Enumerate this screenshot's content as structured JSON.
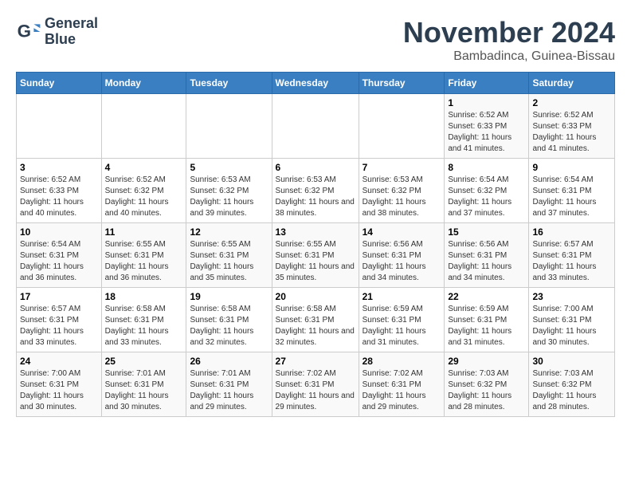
{
  "logo": {
    "line1": "General",
    "line2": "Blue"
  },
  "title": "November 2024",
  "location": "Bambadinca, Guinea-Bissau",
  "weekdays": [
    "Sunday",
    "Monday",
    "Tuesday",
    "Wednesday",
    "Thursday",
    "Friday",
    "Saturday"
  ],
  "weeks": [
    [
      {
        "day": "",
        "info": ""
      },
      {
        "day": "",
        "info": ""
      },
      {
        "day": "",
        "info": ""
      },
      {
        "day": "",
        "info": ""
      },
      {
        "day": "",
        "info": ""
      },
      {
        "day": "1",
        "info": "Sunrise: 6:52 AM\nSunset: 6:33 PM\nDaylight: 11 hours and 41 minutes."
      },
      {
        "day": "2",
        "info": "Sunrise: 6:52 AM\nSunset: 6:33 PM\nDaylight: 11 hours and 41 minutes."
      }
    ],
    [
      {
        "day": "3",
        "info": "Sunrise: 6:52 AM\nSunset: 6:33 PM\nDaylight: 11 hours and 40 minutes."
      },
      {
        "day": "4",
        "info": "Sunrise: 6:52 AM\nSunset: 6:32 PM\nDaylight: 11 hours and 40 minutes."
      },
      {
        "day": "5",
        "info": "Sunrise: 6:53 AM\nSunset: 6:32 PM\nDaylight: 11 hours and 39 minutes."
      },
      {
        "day": "6",
        "info": "Sunrise: 6:53 AM\nSunset: 6:32 PM\nDaylight: 11 hours and 38 minutes."
      },
      {
        "day": "7",
        "info": "Sunrise: 6:53 AM\nSunset: 6:32 PM\nDaylight: 11 hours and 38 minutes."
      },
      {
        "day": "8",
        "info": "Sunrise: 6:54 AM\nSunset: 6:32 PM\nDaylight: 11 hours and 37 minutes."
      },
      {
        "day": "9",
        "info": "Sunrise: 6:54 AM\nSunset: 6:31 PM\nDaylight: 11 hours and 37 minutes."
      }
    ],
    [
      {
        "day": "10",
        "info": "Sunrise: 6:54 AM\nSunset: 6:31 PM\nDaylight: 11 hours and 36 minutes."
      },
      {
        "day": "11",
        "info": "Sunrise: 6:55 AM\nSunset: 6:31 PM\nDaylight: 11 hours and 36 minutes."
      },
      {
        "day": "12",
        "info": "Sunrise: 6:55 AM\nSunset: 6:31 PM\nDaylight: 11 hours and 35 minutes."
      },
      {
        "day": "13",
        "info": "Sunrise: 6:55 AM\nSunset: 6:31 PM\nDaylight: 11 hours and 35 minutes."
      },
      {
        "day": "14",
        "info": "Sunrise: 6:56 AM\nSunset: 6:31 PM\nDaylight: 11 hours and 34 minutes."
      },
      {
        "day": "15",
        "info": "Sunrise: 6:56 AM\nSunset: 6:31 PM\nDaylight: 11 hours and 34 minutes."
      },
      {
        "day": "16",
        "info": "Sunrise: 6:57 AM\nSunset: 6:31 PM\nDaylight: 11 hours and 33 minutes."
      }
    ],
    [
      {
        "day": "17",
        "info": "Sunrise: 6:57 AM\nSunset: 6:31 PM\nDaylight: 11 hours and 33 minutes."
      },
      {
        "day": "18",
        "info": "Sunrise: 6:58 AM\nSunset: 6:31 PM\nDaylight: 11 hours and 33 minutes."
      },
      {
        "day": "19",
        "info": "Sunrise: 6:58 AM\nSunset: 6:31 PM\nDaylight: 11 hours and 32 minutes."
      },
      {
        "day": "20",
        "info": "Sunrise: 6:58 AM\nSunset: 6:31 PM\nDaylight: 11 hours and 32 minutes."
      },
      {
        "day": "21",
        "info": "Sunrise: 6:59 AM\nSunset: 6:31 PM\nDaylight: 11 hours and 31 minutes."
      },
      {
        "day": "22",
        "info": "Sunrise: 6:59 AM\nSunset: 6:31 PM\nDaylight: 11 hours and 31 minutes."
      },
      {
        "day": "23",
        "info": "Sunrise: 7:00 AM\nSunset: 6:31 PM\nDaylight: 11 hours and 30 minutes."
      }
    ],
    [
      {
        "day": "24",
        "info": "Sunrise: 7:00 AM\nSunset: 6:31 PM\nDaylight: 11 hours and 30 minutes."
      },
      {
        "day": "25",
        "info": "Sunrise: 7:01 AM\nSunset: 6:31 PM\nDaylight: 11 hours and 30 minutes."
      },
      {
        "day": "26",
        "info": "Sunrise: 7:01 AM\nSunset: 6:31 PM\nDaylight: 11 hours and 29 minutes."
      },
      {
        "day": "27",
        "info": "Sunrise: 7:02 AM\nSunset: 6:31 PM\nDaylight: 11 hours and 29 minutes."
      },
      {
        "day": "28",
        "info": "Sunrise: 7:02 AM\nSunset: 6:31 PM\nDaylight: 11 hours and 29 minutes."
      },
      {
        "day": "29",
        "info": "Sunrise: 7:03 AM\nSunset: 6:32 PM\nDaylight: 11 hours and 28 minutes."
      },
      {
        "day": "30",
        "info": "Sunrise: 7:03 AM\nSunset: 6:32 PM\nDaylight: 11 hours and 28 minutes."
      }
    ]
  ]
}
